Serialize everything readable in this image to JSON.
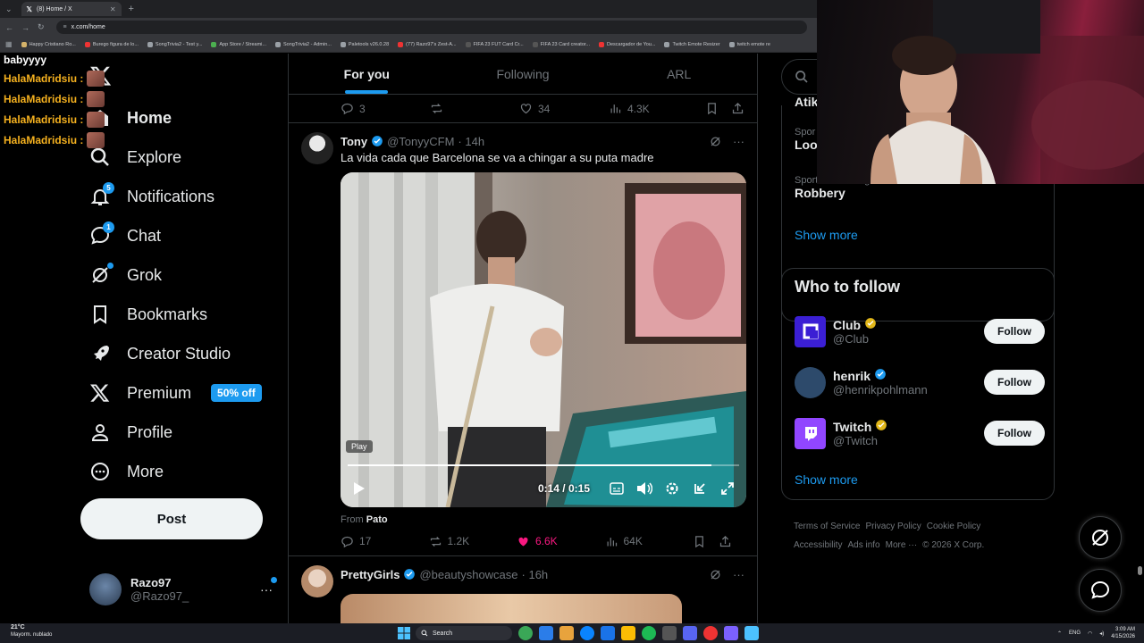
{
  "browser": {
    "tab_title": "(8) Home / X",
    "url": "x.com/home",
    "bookmarks": [
      {
        "label": "Happy Cristiano Ro...",
        "color": "#d4b26a"
      },
      {
        "label": "Burego figura de lo...",
        "color": "#e33"
      },
      {
        "label": "SongTrivia2 - Test y...",
        "color": "#9aa0a6"
      },
      {
        "label": "App Store / Streami...",
        "color": "#4caf50"
      },
      {
        "label": "SongTrivia2 - Admin...",
        "color": "#9aa0a6"
      },
      {
        "label": "Paletools v26.0.28",
        "color": "#9aa0a6"
      },
      {
        "label": "(77) Razo97's Zest-A...",
        "color": "#e33"
      },
      {
        "label": "FIFA 23 FUT Card Cr...",
        "color": "#555"
      },
      {
        "label": "FIFA 23 Card creator...",
        "color": "#555"
      },
      {
        "label": "Descargador de You...",
        "color": "#e33"
      },
      {
        "label": "Twitch Emote Resizer",
        "color": "#9aa0a6"
      },
      {
        "label": "twitch emote re",
        "color": "#9aa0a6"
      }
    ]
  },
  "stream_chat": {
    "header": "babyyyy",
    "lines": [
      {
        "user": "HalaMadridsiu :"
      },
      {
        "user": "HalaMadridsiu :"
      },
      {
        "user": "HalaMadridsiu :"
      },
      {
        "user": "HalaMadridsiu :"
      }
    ]
  },
  "sidebar": {
    "items": [
      {
        "label": "Home",
        "icon": "home-icon"
      },
      {
        "label": "Explore",
        "icon": "search-icon"
      },
      {
        "label": "Notifications",
        "icon": "bell-icon",
        "badge": "5"
      },
      {
        "label": "Chat",
        "icon": "chat-icon",
        "badge": "1"
      },
      {
        "label": "Grok",
        "icon": "grok-icon"
      },
      {
        "label": "Bookmarks",
        "icon": "bookmark-icon"
      },
      {
        "label": "Creator Studio",
        "icon": "rocket-icon"
      },
      {
        "label": "Premium",
        "icon": "x-logo-icon",
        "badge_text": "50% off"
      },
      {
        "label": "Profile",
        "icon": "person-icon"
      },
      {
        "label": "More",
        "icon": "more-circle-icon"
      }
    ],
    "post_label": "Post",
    "account": {
      "name": "Razo97",
      "handle": "@Razo97_",
      "more": "···"
    }
  },
  "timeline": {
    "tabs": [
      {
        "label": "For you",
        "active": true
      },
      {
        "label": "Following",
        "active": false
      },
      {
        "label": "ARL",
        "active": false
      }
    ],
    "prev_actions": {
      "replies": "3",
      "reposts": "",
      "likes": "34",
      "views": "4.3K"
    },
    "tweets": [
      {
        "name": "Tony",
        "handle": "@TonyyCFM",
        "time": "· 14h",
        "text": "La vida cada que Barcelona se va a chingar a su puta madre",
        "video": {
          "tooltip": "Play",
          "time": "0:14 / 0:15",
          "progress": 0.93
        },
        "from_prefix": "From",
        "from_name": "Pato",
        "actions": {
          "replies": "17",
          "reposts": "1.2K",
          "likes": "6.6K",
          "views": "64K",
          "liked": true
        }
      },
      {
        "name": "PrettyGirls",
        "handle": "@beautyshowcase",
        "time": "· 16h"
      }
    ]
  },
  "right": {
    "search_placeholder": "Se",
    "trends": [
      {
        "category": "",
        "name": "Atik"
      },
      {
        "category": "Spor",
        "name": "Lool"
      },
      {
        "category": "Sports · Trending",
        "name": "Robbery"
      }
    ],
    "show_more": "Show more",
    "who_to_follow": {
      "title": "Who to follow",
      "accounts": [
        {
          "name": "Club",
          "handle": "@Club",
          "badge": "gold",
          "avatar_color": "#3b1fd4"
        },
        {
          "name": "henrik",
          "handle": "@henrikpohlmann",
          "badge": "blue",
          "avatar_color": "#2d4a6b"
        },
        {
          "name": "Twitch",
          "handle": "@Twitch",
          "badge": "gold",
          "avatar_color": "#9146ff"
        }
      ],
      "follow_label": "Follow",
      "show_more": "Show more"
    },
    "footer": [
      "Terms of Service",
      "Privacy Policy",
      "Cookie Policy",
      "Accessibility",
      "Ads info",
      "More ···",
      "© 2026 X Corp."
    ]
  },
  "taskbar": {
    "weather_temp": "21°C",
    "weather_desc": "Mayorm. nublado",
    "search_label": "Search",
    "lang": "ENG",
    "time": "3:09 AM",
    "date": "4/15/2026"
  },
  "colors": {
    "accent": "#1d9bf0",
    "like": "#f91880",
    "background": "#000000"
  }
}
